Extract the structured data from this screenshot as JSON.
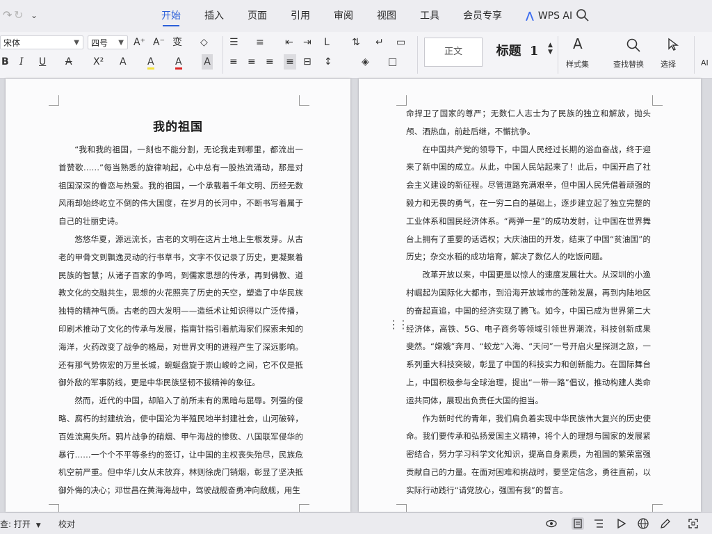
{
  "menubar": {
    "tabs": [
      {
        "label": "开始",
        "active": true
      },
      {
        "label": "插入"
      },
      {
        "label": "页面"
      },
      {
        "label": "引用"
      },
      {
        "label": "审阅"
      },
      {
        "label": "视图"
      },
      {
        "label": "工具"
      },
      {
        "label": "会员专享"
      },
      {
        "label": "WPS AI"
      }
    ],
    "accent_color": "#2b5fd9"
  },
  "ribbon": {
    "font_name": "宋体",
    "font_size": "四号",
    "styles": {
      "normal": "正文",
      "heading": "标题",
      "heading_num": "1"
    },
    "style_set_label": "样式集",
    "find_replace_label": "查找替换",
    "select_label": "选择",
    "ai_label": "AI",
    "buttons": {
      "bold": "B",
      "italic": "I",
      "underline": "U",
      "strike": "A",
      "superscript": "X²",
      "text_effect": "A",
      "highlight": "A",
      "font_color": "A",
      "char_shade": "A",
      "font_grow": "A⁺",
      "font_shrink": "A⁻",
      "clear_format": "◇"
    }
  },
  "document": {
    "title": "我的祖国",
    "left_paragraphs": [
      "“我和我的祖国，一刻也不能分割，无论我走到哪里，都流出一首赞歌……”每当熟悉的旋律响起，心中总有一股热流涌动，那是对祖国深深的眷恋与热爱。我的祖国，一个承载着千年文明、历经无数风雨却始终屹立不倒的伟大国度，在岁月的长河中，不断书写着属于自己的壮丽史诗。",
      "悠悠华夏，源远流长，古老的文明在这片土地上生根发芽。从古老的甲骨文到飘逸灵动的行书草书，文字不仅记录了历史，更凝聚着民族的智慧；从诸子百家的争鸣，到儒家思想的传承，再到佛教、道教文化的交融共生，思想的火花照亮了历史的天空，塑造了中华民族独特的精神气质。古老的四大发明——造纸术让知识得以广泛传播，印刷术推动了文化的传承与发展，指南针指引着航海家们探索未知的海洋，火药改变了战争的格局，对世界文明的进程产生了深远影响。还有那气势恢宏的万里长城，蜿蜒盘旋于崇山峻岭之间，它不仅是抵御外敌的军事防线，更是中华民族坚韧不拔精神的象征。",
      "然而，近代的中国，却陷入了前所未有的黑暗与屈辱。列强的侵略、腐朽的封建统治，使中国沦为半殖民地半封建社会，山河破碎，百姓流离失所。鸦片战争的硝烟、甲午海战的惨败、八国联军侵华的暴行……一个个不平等条约的签订，让中国的主权丧失殆尽，民族危机空前严重。但中华儿女从未放弃，林则徐虎门销烟，彰显了坚决抵御外侮的决心；邓世昌在黄海海战中，驾驶战舰奋勇冲向敌舰，用生"
    ],
    "right_paragraphs": [
      "命捍卫了国家的尊严；无数仁人志士为了民族的独立和解放，抛头颅、洒热血，前赴后继，不懈抗争。",
      "在中国共产党的领导下，中国人民经过长期的浴血奋战，终于迎来了新中国的成立。从此，中国人民站起来了！此后，中国开启了社会主义建设的新征程。尽管道路充满艰辛，但中国人民凭借着顽强的毅力和无畏的勇气，在一穷二白的基础上，逐步建立起了独立完整的工业体系和国民经济体系。“两弹一星”的成功发射，让中国在世界舞台上拥有了重要的话语权；大庆油田的开发，结束了中国“贫油国”的历史；杂交水稻的成功培育，解决了数亿人的吃饭问题。",
      "改革开放以来，中国更是以惊人的速度发展壮大。从深圳的小渔村崛起为国际化大都市，到沿海开放城市的蓬勃发展，再到内陆地区的奋起直追，中国的经济实现了腾飞。如今，中国已成为世界第二大经济体，高铁、5G、电子商务等领域引领世界潮流，科技创新成果斐然。“嫦娥”奔月、“蛟龙”入海、“天问”一号开启火星探测之旅，一系列重大科技突破，彰显了中国的科技实力和创新能力。在国际舞台上，中国积极参与全球治理，提出“一带一路”倡议，推动构建人类命运共同体，展现出负责任大国的担当。",
      "作为新时代的青年，我们肩负着实现中华民族伟大复兴的历史使命。我们要传承和弘扬爱国主义精神，将个人的理想与国家的发展紧密结合，努力学习科学文化知识，提高自身素质，为祖国的繁荣富强贡献自己的力量。在面对困难和挑战时，要坚定信念，勇往直前，以实际行动践行“请党放心，强国有我”的誓言。"
    ]
  },
  "statusbar": {
    "spell_check": "查: 打开",
    "proofread": "校对"
  }
}
